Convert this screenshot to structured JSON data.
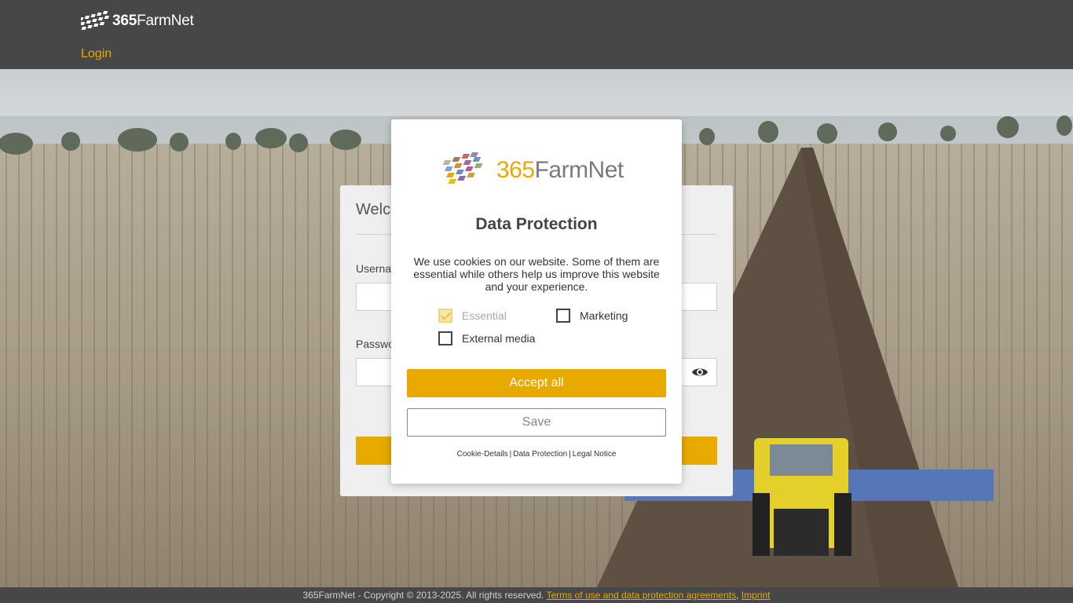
{
  "header": {
    "logo_num": "365",
    "logo_name": "FarmNet",
    "nav_login": "Login"
  },
  "login_card": {
    "title": "Welc",
    "username_label": "Userna",
    "password_label": "Passwo"
  },
  "modal": {
    "logo_num": "365",
    "logo_name": "FarmNet",
    "title": "Data Protection",
    "text": "We use cookies on our website. Some of them are essential while others help us improve this website and your experience.",
    "options": {
      "essential": "Essential",
      "marketing": "Marketing",
      "external_media": "External media"
    },
    "accept_all": "Accept all",
    "save": "Save",
    "links": {
      "cookie_details": "Cookie-Details",
      "data_protection": "Data Protection",
      "legal_notice": "Legal Notice"
    }
  },
  "footer": {
    "copyright": "365FarmNet - Copyright © 2013-2025. All rights reserved.",
    "terms": "Terms of use and data protection agreements",
    "separator": ",",
    "imprint": "Imprint"
  },
  "colors": {
    "accent": "#e8a900",
    "header_bg": "#474747"
  }
}
